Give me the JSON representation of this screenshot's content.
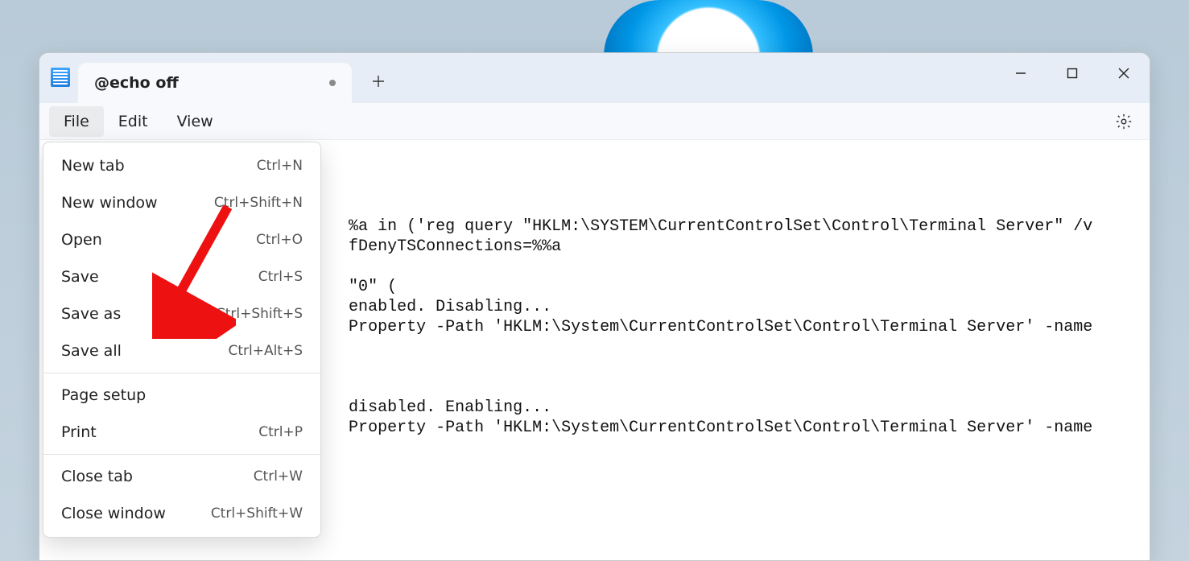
{
  "tab": {
    "title": "@echo off"
  },
  "menubar": {
    "file": "File",
    "edit": "Edit",
    "view": "View"
  },
  "dropdown": {
    "items": [
      {
        "label": "New tab",
        "shortcut": "Ctrl+N"
      },
      {
        "label": "New window",
        "shortcut": "Ctrl+Shift+N"
      },
      {
        "label": "Open",
        "shortcut": "Ctrl+O"
      },
      {
        "label": "Save",
        "shortcut": "Ctrl+S"
      },
      {
        "label": "Save as",
        "shortcut": "Ctrl+Shift+S"
      },
      {
        "label": "Save all",
        "shortcut": "Ctrl+Alt+S"
      }
    ],
    "items2": [
      {
        "label": "Page setup",
        "shortcut": ""
      },
      {
        "label": "Print",
        "shortcut": "Ctrl+P"
      }
    ],
    "items3": [
      {
        "label": "Close tab",
        "shortcut": "Ctrl+W"
      },
      {
        "label": "Close window",
        "shortcut": "Ctrl+Shift+W"
      }
    ]
  },
  "editor": {
    "lines": [
      "",
      "",
      "",
      "%a in ('reg query \"HKLM:\\SYSTEM\\CurrentControlSet\\Control\\Terminal Server\" /v",
      "fDenyTSConnections=%%a",
      "",
      "\"0\" (",
      "enabled. Disabling...",
      "Property -Path 'HKLM:\\System\\CurrentControlSet\\Control\\Terminal Server' -name",
      "",
      "",
      "",
      "disabled. Enabling...",
      "Property -Path 'HKLM:\\System\\CurrentControlSet\\Control\\Terminal Server' -name"
    ]
  }
}
